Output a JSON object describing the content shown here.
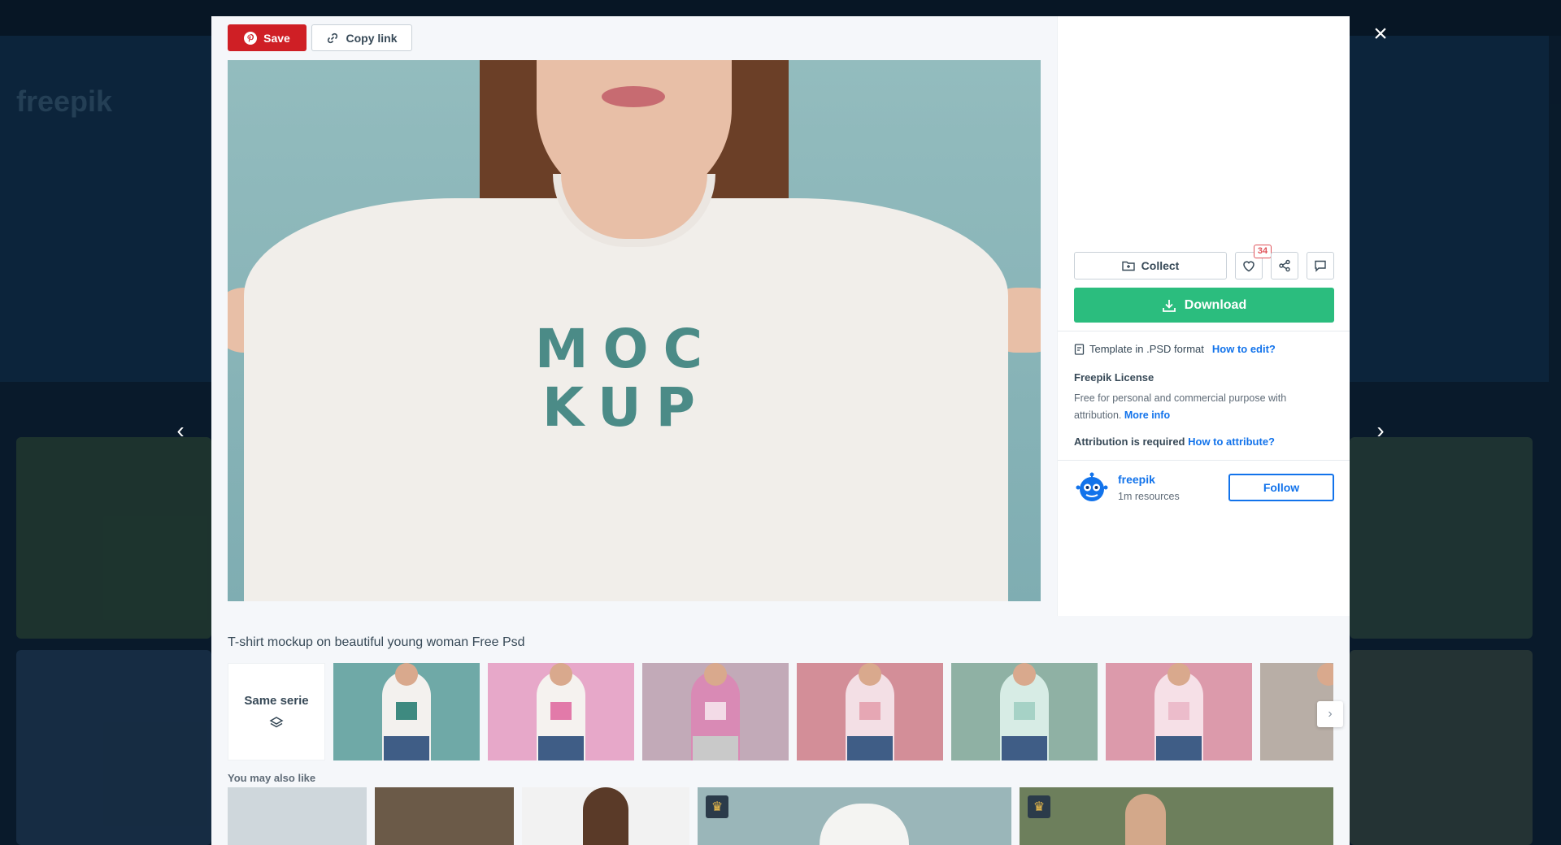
{
  "modal": {
    "save_label": "Save",
    "copy_link_label": "Copy link",
    "collect_label": "Collect",
    "like_count": "34",
    "download_label": "Download",
    "format_text": "Template in .PSD format",
    "how_to_edit": "How to edit?",
    "license_title": "Freepik License",
    "license_text": "Free for personal and commercial purpose with attribution.",
    "more_info": "More info",
    "attribution_text": "Attribution is required",
    "how_to_attribute": "How to attribute?",
    "author_name": "freepik",
    "author_resources": "1m resources",
    "follow_label": "Follow",
    "image_text_line1": "MOC",
    "image_text_line2": "KUP"
  },
  "series": {
    "title": "T-shirt mockup on beautiful young woman Free Psd",
    "same_serie_label": "Same serie"
  },
  "related": {
    "title": "You may also like"
  },
  "background": {
    "logo": "freepik"
  },
  "colors": {
    "save_red": "#cf1f25",
    "download_green": "#2bbd7e",
    "link_blue": "#1273eb",
    "image_bg": "#8fb9bb"
  }
}
